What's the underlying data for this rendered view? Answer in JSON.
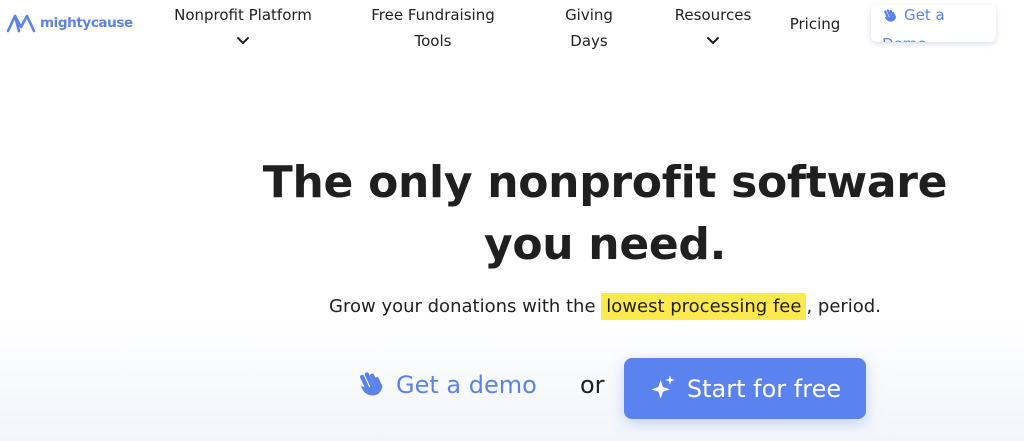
{
  "brand": {
    "name": "mightycause",
    "color": "#5b83e8"
  },
  "nav": {
    "items": [
      {
        "label": "Nonprofit Platform",
        "has_dropdown": true
      },
      {
        "label": "Free Fundraising Tools",
        "has_dropdown": false
      },
      {
        "label": "Giving Days",
        "has_dropdown": false
      },
      {
        "label": "Resources",
        "has_dropdown": true
      },
      {
        "label": "Pricing",
        "has_dropdown": false
      }
    ],
    "demo_button": {
      "label": "Get a Demo",
      "icon": "waving-hand-icon"
    }
  },
  "hero": {
    "title": "The only nonprofit software you need.",
    "subtitle_before": "Grow your donations with the ",
    "subtitle_highlight": "lowest processing fee",
    "subtitle_after": ", period.",
    "highlight_color": "#fbe94d"
  },
  "cta": {
    "demo_label": "Get a demo",
    "demo_icon": "waving-hand-icon",
    "or_label": "or",
    "start_label": "Start for free",
    "start_icon": "sparkles-icon",
    "start_color": "#5b83f0"
  }
}
